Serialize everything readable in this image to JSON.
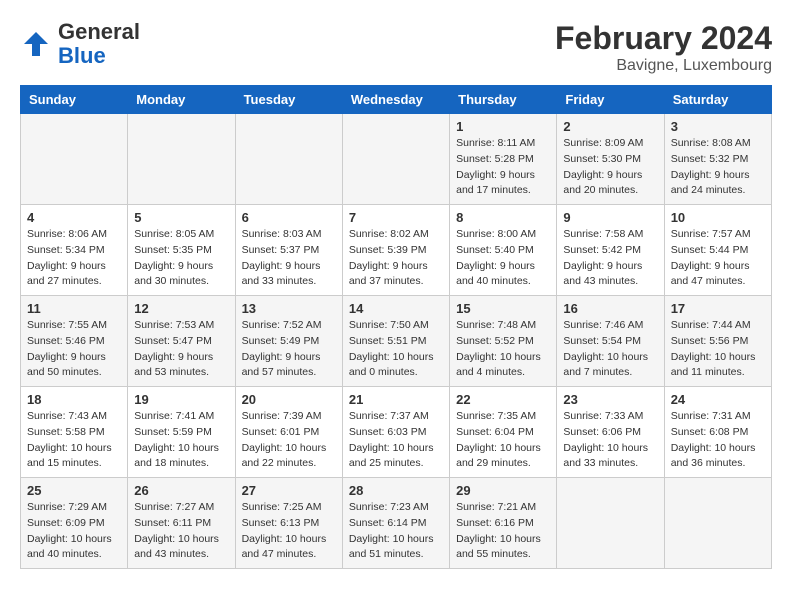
{
  "header": {
    "logo_general": "General",
    "logo_blue": "Blue",
    "month_year": "February 2024",
    "location": "Bavigne, Luxembourg"
  },
  "weekdays": [
    "Sunday",
    "Monday",
    "Tuesday",
    "Wednesday",
    "Thursday",
    "Friday",
    "Saturday"
  ],
  "weeks": [
    [
      {
        "day": "",
        "info": ""
      },
      {
        "day": "",
        "info": ""
      },
      {
        "day": "",
        "info": ""
      },
      {
        "day": "",
        "info": ""
      },
      {
        "day": "1",
        "info": "Sunrise: 8:11 AM\nSunset: 5:28 PM\nDaylight: 9 hours\nand 17 minutes."
      },
      {
        "day": "2",
        "info": "Sunrise: 8:09 AM\nSunset: 5:30 PM\nDaylight: 9 hours\nand 20 minutes."
      },
      {
        "day": "3",
        "info": "Sunrise: 8:08 AM\nSunset: 5:32 PM\nDaylight: 9 hours\nand 24 minutes."
      }
    ],
    [
      {
        "day": "4",
        "info": "Sunrise: 8:06 AM\nSunset: 5:34 PM\nDaylight: 9 hours\nand 27 minutes."
      },
      {
        "day": "5",
        "info": "Sunrise: 8:05 AM\nSunset: 5:35 PM\nDaylight: 9 hours\nand 30 minutes."
      },
      {
        "day": "6",
        "info": "Sunrise: 8:03 AM\nSunset: 5:37 PM\nDaylight: 9 hours\nand 33 minutes."
      },
      {
        "day": "7",
        "info": "Sunrise: 8:02 AM\nSunset: 5:39 PM\nDaylight: 9 hours\nand 37 minutes."
      },
      {
        "day": "8",
        "info": "Sunrise: 8:00 AM\nSunset: 5:40 PM\nDaylight: 9 hours\nand 40 minutes."
      },
      {
        "day": "9",
        "info": "Sunrise: 7:58 AM\nSunset: 5:42 PM\nDaylight: 9 hours\nand 43 minutes."
      },
      {
        "day": "10",
        "info": "Sunrise: 7:57 AM\nSunset: 5:44 PM\nDaylight: 9 hours\nand 47 minutes."
      }
    ],
    [
      {
        "day": "11",
        "info": "Sunrise: 7:55 AM\nSunset: 5:46 PM\nDaylight: 9 hours\nand 50 minutes."
      },
      {
        "day": "12",
        "info": "Sunrise: 7:53 AM\nSunset: 5:47 PM\nDaylight: 9 hours\nand 53 minutes."
      },
      {
        "day": "13",
        "info": "Sunrise: 7:52 AM\nSunset: 5:49 PM\nDaylight: 9 hours\nand 57 minutes."
      },
      {
        "day": "14",
        "info": "Sunrise: 7:50 AM\nSunset: 5:51 PM\nDaylight: 10 hours\nand 0 minutes."
      },
      {
        "day": "15",
        "info": "Sunrise: 7:48 AM\nSunset: 5:52 PM\nDaylight: 10 hours\nand 4 minutes."
      },
      {
        "day": "16",
        "info": "Sunrise: 7:46 AM\nSunset: 5:54 PM\nDaylight: 10 hours\nand 7 minutes."
      },
      {
        "day": "17",
        "info": "Sunrise: 7:44 AM\nSunset: 5:56 PM\nDaylight: 10 hours\nand 11 minutes."
      }
    ],
    [
      {
        "day": "18",
        "info": "Sunrise: 7:43 AM\nSunset: 5:58 PM\nDaylight: 10 hours\nand 15 minutes."
      },
      {
        "day": "19",
        "info": "Sunrise: 7:41 AM\nSunset: 5:59 PM\nDaylight: 10 hours\nand 18 minutes."
      },
      {
        "day": "20",
        "info": "Sunrise: 7:39 AM\nSunset: 6:01 PM\nDaylight: 10 hours\nand 22 minutes."
      },
      {
        "day": "21",
        "info": "Sunrise: 7:37 AM\nSunset: 6:03 PM\nDaylight: 10 hours\nand 25 minutes."
      },
      {
        "day": "22",
        "info": "Sunrise: 7:35 AM\nSunset: 6:04 PM\nDaylight: 10 hours\nand 29 minutes."
      },
      {
        "day": "23",
        "info": "Sunrise: 7:33 AM\nSunset: 6:06 PM\nDaylight: 10 hours\nand 33 minutes."
      },
      {
        "day": "24",
        "info": "Sunrise: 7:31 AM\nSunset: 6:08 PM\nDaylight: 10 hours\nand 36 minutes."
      }
    ],
    [
      {
        "day": "25",
        "info": "Sunrise: 7:29 AM\nSunset: 6:09 PM\nDaylight: 10 hours\nand 40 minutes."
      },
      {
        "day": "26",
        "info": "Sunrise: 7:27 AM\nSunset: 6:11 PM\nDaylight: 10 hours\nand 43 minutes."
      },
      {
        "day": "27",
        "info": "Sunrise: 7:25 AM\nSunset: 6:13 PM\nDaylight: 10 hours\nand 47 minutes."
      },
      {
        "day": "28",
        "info": "Sunrise: 7:23 AM\nSunset: 6:14 PM\nDaylight: 10 hours\nand 51 minutes."
      },
      {
        "day": "29",
        "info": "Sunrise: 7:21 AM\nSunset: 6:16 PM\nDaylight: 10 hours\nand 55 minutes."
      },
      {
        "day": "",
        "info": ""
      },
      {
        "day": "",
        "info": ""
      }
    ]
  ]
}
